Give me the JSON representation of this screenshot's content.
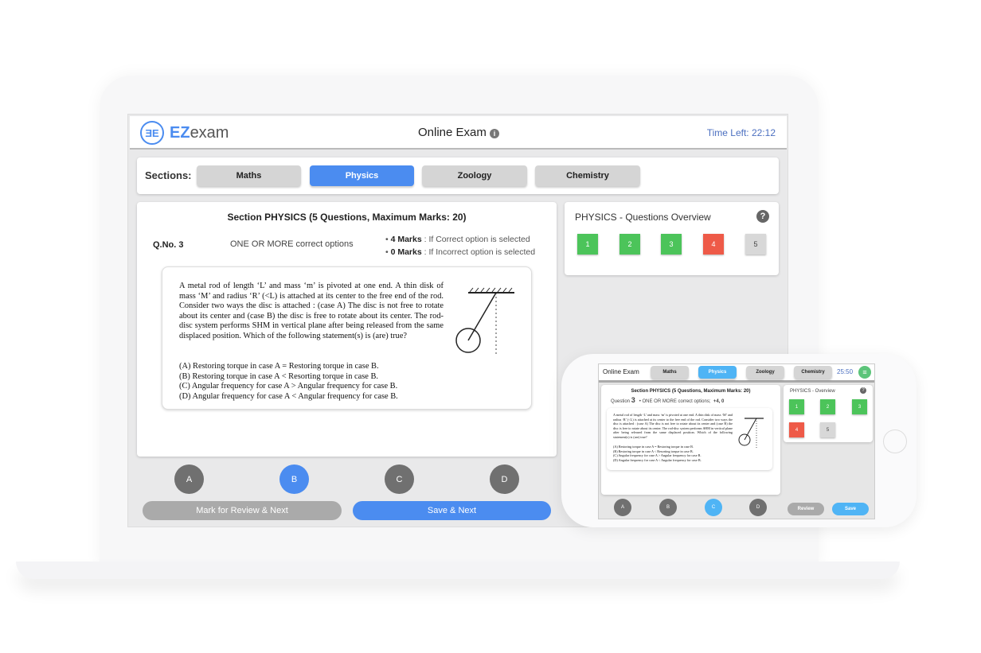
{
  "header": {
    "logo_mark": "ƎE",
    "logo_ez": "EZ",
    "logo_exam": "exam",
    "title": "Online Exam",
    "info_icon": "info-icon",
    "time_left": "Time Left: 22:12"
  },
  "sections": {
    "label": "Sections:",
    "tabs": [
      {
        "label": "Maths"
      },
      {
        "label": "Physics",
        "active": true
      },
      {
        "label": "Zoology"
      },
      {
        "label": "Chemistry"
      }
    ]
  },
  "question": {
    "section_title": "Section PHYSICS (5 Questions, Maximum Marks: 20)",
    "qno": "Q.No. 3",
    "type": "ONE OR MORE correct options",
    "marks": [
      {
        "bold": "4 Marks",
        "text": " : If Correct option is selected"
      },
      {
        "bold": "0 Marks",
        "text": " : If Incorrect option is selected"
      }
    ],
    "body": "A metal rod of length ‘L’ and mass ‘m’ is pivoted at one end. A thin disk of mass ‘M’ and radius ‘R’ (<L) is attached at its center to the free end of the rod. Consider two ways the disc is attached : (case A) The disc is not free to rotate about its center and (case B) the disc is free to rotate about its center. The rod-disc system performs SHM in vertical plane after being released from the same displaced position. Which of the following statement(s) is (are) true?",
    "choices": [
      "(A) Restoring torque in case A = Restoring torque in case B.",
      "(B) Restoring torque in case A < Resorting torque in case B.",
      "(C) Angular frequency for case A > Angular frequency for case B.",
      "(D) Angular frequency for case A < Angular frequency for case B."
    ]
  },
  "overview": {
    "title": "PHYSICS - Questions Overview",
    "help_icon": "question-circle-icon",
    "tiles": [
      {
        "n": "1",
        "status": "answered",
        "color": "#4cc45a"
      },
      {
        "n": "2",
        "status": "answered",
        "color": "#4cc45a"
      },
      {
        "n": "3",
        "status": "answered",
        "color": "#4cc45a"
      },
      {
        "n": "4",
        "status": "incorrect",
        "color": "#ee5a48"
      },
      {
        "n": "5",
        "status": "unvisited",
        "color": "#d8d8d8"
      }
    ]
  },
  "options": [
    {
      "label": "A"
    },
    {
      "label": "B",
      "selected": true
    },
    {
      "label": "C"
    },
    {
      "label": "D"
    }
  ],
  "actions": {
    "review": "Mark for Review & Next",
    "save": "Save & Next"
  },
  "colors": {
    "accent": "#4b8cf0",
    "phone_accent": "#4fb4f5",
    "green": "#4cc45a",
    "red": "#ee5a48"
  },
  "phone": {
    "title": "Online Exam",
    "tabs": [
      "Maths",
      "Physics",
      "Zoology",
      "Chemistry"
    ],
    "timer": "25:50",
    "menu_icon": "hamburger-icon",
    "section_title": "Section PHYSICS (5 Questions, Maximum Marks: 20)",
    "question_label": "Question",
    "question_no": "3",
    "type": "ONE OR MORE correct options;",
    "marks": "+4, 0",
    "overview_title": "PHYSICS - Overview",
    "options": [
      "A",
      "B",
      "C",
      "D"
    ],
    "selected_option": "C",
    "review": "Review",
    "save": "Save"
  }
}
